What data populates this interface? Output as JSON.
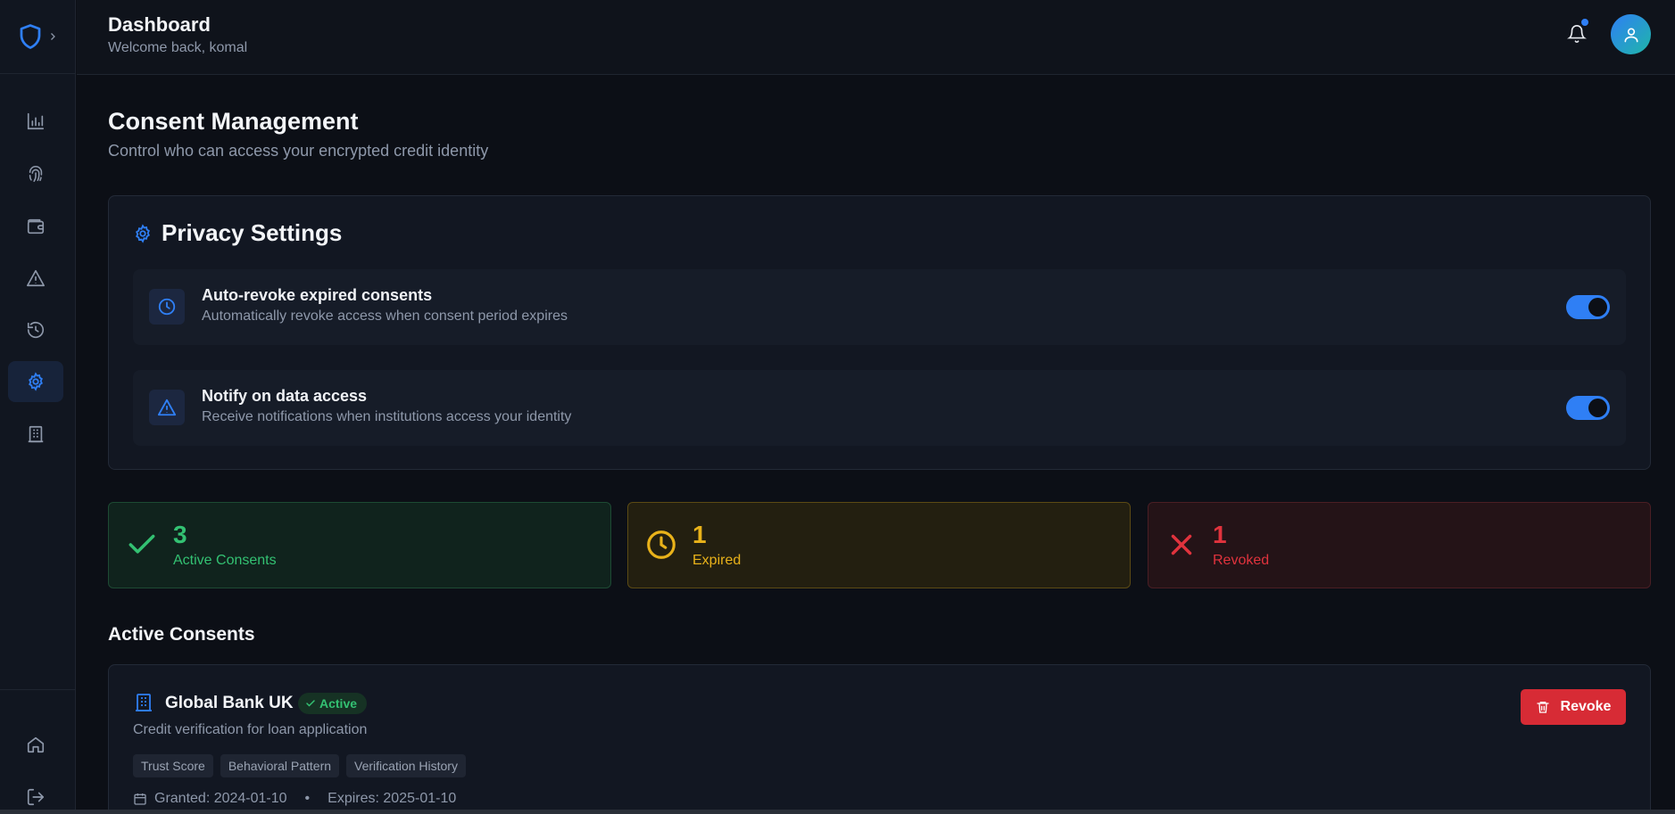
{
  "header": {
    "title": "Dashboard",
    "subtitle": "Welcome back, komal"
  },
  "sidebar": {
    "items": [
      {
        "icon": "bar-chart-icon"
      },
      {
        "icon": "fingerprint-icon"
      },
      {
        "icon": "wallet-icon"
      },
      {
        "icon": "alert-triangle-icon"
      },
      {
        "icon": "history-icon"
      },
      {
        "icon": "gear-icon",
        "active": true
      },
      {
        "icon": "building-icon"
      }
    ],
    "bottom": [
      {
        "icon": "home-icon"
      },
      {
        "icon": "logout-icon"
      }
    ]
  },
  "page": {
    "title": "Consent Management",
    "subtitle": "Control who can access your encrypted credit identity"
  },
  "privacy": {
    "title": "Privacy Settings",
    "settings": [
      {
        "label": "Auto-revoke expired consents",
        "description": "Automatically revoke access when consent period expires",
        "enabled": true,
        "icon": "clock-icon"
      },
      {
        "label": "Notify on data access",
        "description": "Receive notifications when institutions access your identity",
        "enabled": true,
        "icon": "alert-triangle-icon"
      }
    ]
  },
  "stats": [
    {
      "value": "3",
      "label": "Active Consents",
      "color": "#33c172"
    },
    {
      "value": "1",
      "label": "Expired",
      "color": "#e9b21a"
    },
    {
      "value": "1",
      "label": "Revoked",
      "color": "#e0333d"
    }
  ],
  "active_section": {
    "title": "Active Consents"
  },
  "consents": [
    {
      "name": "Global Bank UK",
      "status": "Active",
      "purpose": "Credit verification for loan application",
      "tags": [
        "Trust Score",
        "Behavioral Pattern",
        "Verification History"
      ],
      "granted": "Granted: 2024-01-10",
      "separator": "•",
      "expires": "Expires: 2025-01-10",
      "action_label": "Revoke"
    }
  ],
  "colors": {
    "accent": "#2f7ff5",
    "background": "#0c0f16",
    "danger": "#d72b35"
  }
}
